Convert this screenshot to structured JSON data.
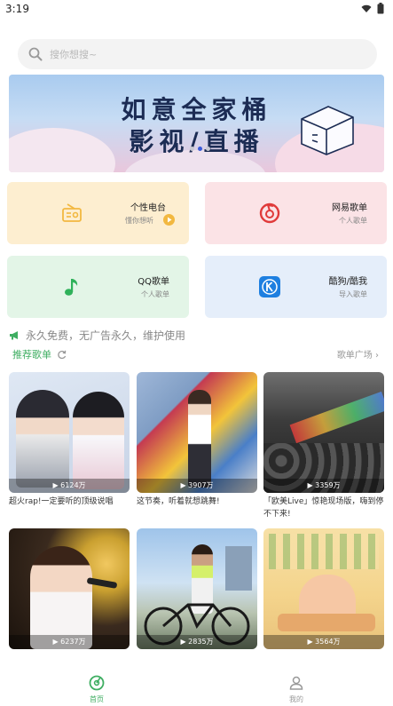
{
  "status": {
    "time": "3:19"
  },
  "search": {
    "placeholder": "搜你想搜~"
  },
  "banner": {
    "line1": "如意全家桶",
    "line2": "影视/直播"
  },
  "cards": [
    {
      "title": "个性电台",
      "subtitle": "懂你想听",
      "color": "#fdeed0"
    },
    {
      "title": "网易歌单",
      "subtitle": "个人歌单",
      "color": "#fbe3e6"
    },
    {
      "title": "QQ歌单",
      "subtitle": "个人歌单",
      "color": "#e3f5e7"
    },
    {
      "title": "酷狗/酷我",
      "subtitle": "导入歌单",
      "color": "#e5eefa"
    }
  ],
  "notice": "永久免费，无广告永久，维护使用",
  "section": {
    "title": "推荐歌单",
    "more": "歌单广场"
  },
  "playlists": [
    {
      "count": "6124万",
      "caption": "超火rap!一定要听的顶级说唱"
    },
    {
      "count": "3907万",
      "caption": "这节奏，听着就想跳舞!"
    },
    {
      "count": "3359万",
      "caption": "「欧美Live」惊艳现场版，嗨到停不下来!"
    },
    {
      "count": "6237万",
      "caption": ""
    },
    {
      "count": "2835万",
      "caption": ""
    },
    {
      "count": "3564万",
      "caption": ""
    }
  ],
  "tabs": [
    {
      "label": "首页",
      "active": true
    },
    {
      "label": "我的",
      "active": false
    }
  ],
  "colors": {
    "accent": "#3fae62"
  }
}
